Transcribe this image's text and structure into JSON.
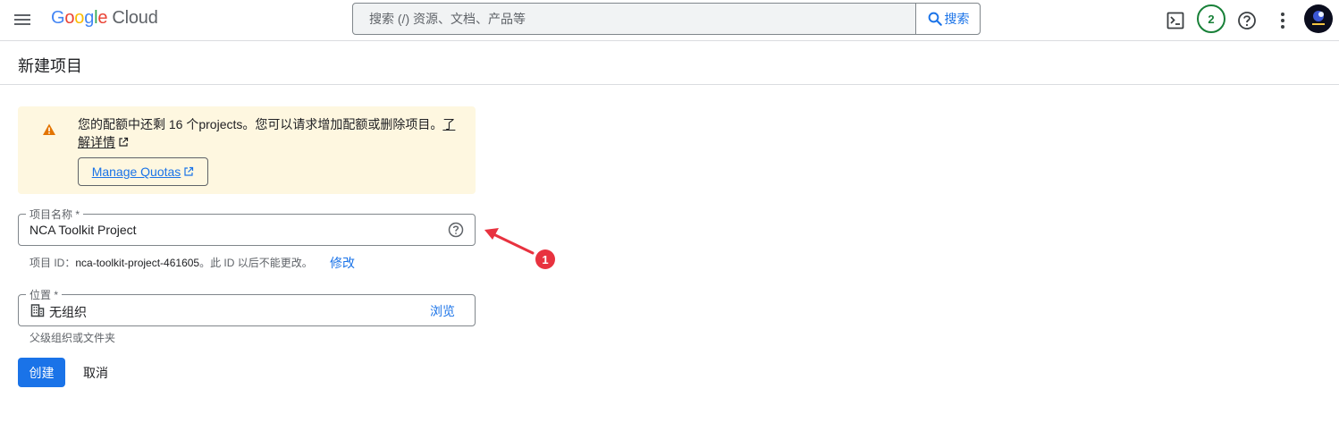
{
  "header": {
    "logo_google": "Google",
    "logo_cloud": "Cloud",
    "search_placeholder": "搜索 (/) 资源、文档、产品等",
    "search_button": "搜索",
    "notification_count": "2"
  },
  "page": {
    "title": "新建项目"
  },
  "banner": {
    "message": "您的配额中还剩 16 个projects。您可以请求增加配额或删除项目。",
    "learn_more": "了解详情",
    "manage_quotas": "Manage Quotas"
  },
  "form": {
    "project_name_label": "项目名称 *",
    "project_name_value": "NCA Toolkit Project",
    "project_id_prefix": "项目 ID：",
    "project_id_value": "nca-toolkit-project-461605",
    "project_id_suffix": "。此 ID 以后不能更改。",
    "edit_link": "修改",
    "location_label": "位置 *",
    "location_value": "无组织",
    "browse_link": "浏览",
    "location_hint": "父级组织或文件夹",
    "create_button": "创建",
    "cancel_button": "取消"
  },
  "annotation": {
    "step_number": "1"
  },
  "colors": {
    "primary": "#1a73e8",
    "warning_bg": "#fef7e0",
    "warning_icon": "#e37400",
    "badge_green": "#188038",
    "annotation_red": "#e8323f"
  }
}
